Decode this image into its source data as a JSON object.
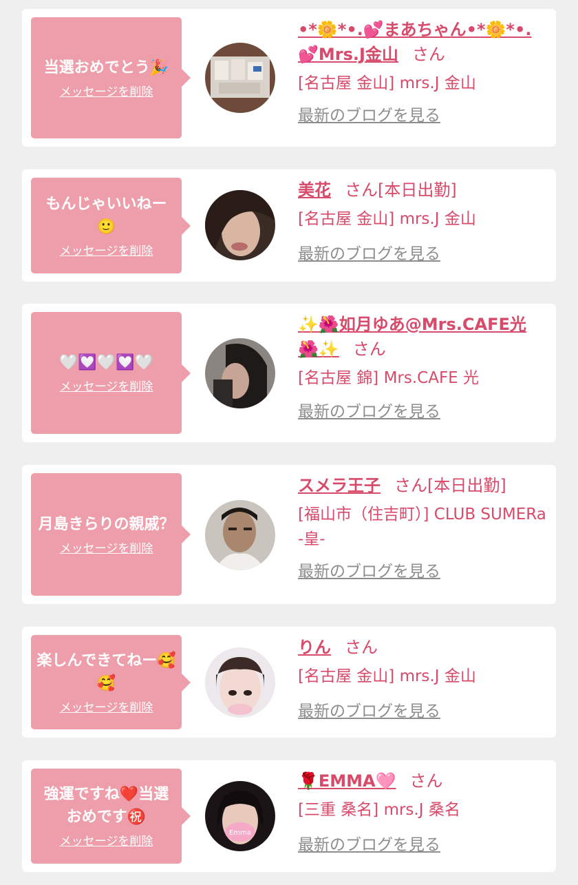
{
  "delete_label": "メッセージを削除",
  "blog_label": "最新のブログを見る",
  "san_label": "さん",
  "cards": [
    {
      "message": "当選おめでとう🎉",
      "name": "•*🌼*•.💕まあちゃん•*🌼*•.💕Mrs.J金山",
      "tag": "",
      "shop": "[名古屋 金山] mrs.J 金山"
    },
    {
      "message": "もんじゃいいねー🙂",
      "name": "美花",
      "tag": "[本日出勤]",
      "shop": "[名古屋 金山] mrs.J 金山"
    },
    {
      "message": "🤍💟🤍💟🤍",
      "name": "✨🌺如月ゆあ@Mrs.CAFE光🌺✨",
      "tag": "",
      "shop": "[名古屋 錦] Mrs.CAFE 光"
    },
    {
      "message": "月島きらりの親戚？",
      "name": "スメラ王子",
      "tag": "[本日出勤]",
      "shop": "[福山市（住吉町）] CLUB SUMERa -皇-"
    },
    {
      "message": "楽しんできてねー🥰🥰",
      "name": "りん",
      "tag": "",
      "shop": "[名古屋 金山] mrs.J 金山"
    },
    {
      "message": "強運ですね❤️当選おめです㊗️",
      "name": "🌹EMMA🩷",
      "tag": "",
      "shop": "[三重 桑名] mrs.J 桑名"
    }
  ]
}
